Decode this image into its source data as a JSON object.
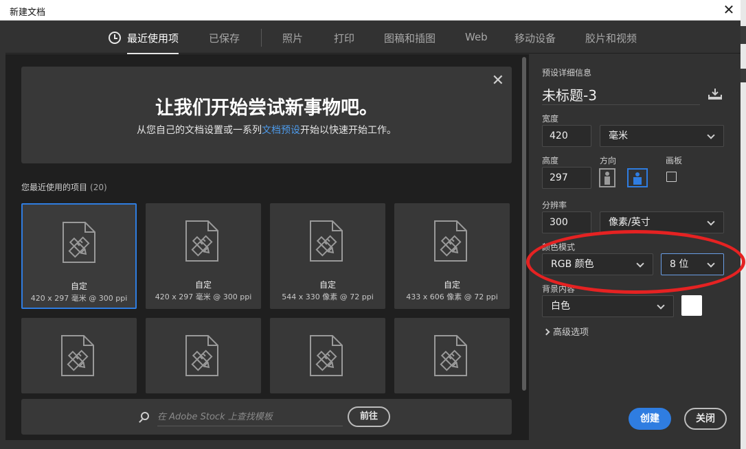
{
  "window": {
    "title": "新建文档",
    "close_glyph": "✕"
  },
  "tabs": [
    {
      "label": "最近使用项",
      "active": true
    },
    {
      "label": "已保存"
    },
    {
      "label": "照片"
    },
    {
      "label": "打印"
    },
    {
      "label": "图稿和插图"
    },
    {
      "label": "Web"
    },
    {
      "label": "移动设备"
    },
    {
      "label": "胶片和视频"
    }
  ],
  "hero": {
    "headline": "让我们开始尝试新事物吧。",
    "text_before": "从您自己的文档设置或一系列",
    "link": "文档预设",
    "text_after": "开始以快速开始工作。",
    "close_glyph": "✕"
  },
  "recent": {
    "heading": "您最近使用的项目",
    "count": "(20)",
    "items": [
      {
        "name": "自定",
        "meta": "420 x 297 毫米 @ 300 ppi",
        "selected": true
      },
      {
        "name": "自定",
        "meta": "420 x 297 毫米 @ 300 ppi"
      },
      {
        "name": "自定",
        "meta": "544 x 330 像素 @ 72 ppi"
      },
      {
        "name": "自定",
        "meta": "433 x 606 像素 @ 72 ppi"
      },
      {
        "name": "",
        "meta": ""
      },
      {
        "name": "",
        "meta": ""
      },
      {
        "name": "",
        "meta": ""
      },
      {
        "name": "",
        "meta": ""
      }
    ]
  },
  "stock": {
    "placeholder": "在 Adobe Stock 上查找模板",
    "go_label": "前往"
  },
  "details": {
    "heading": "预设详细信息",
    "doc_name": "未标题-3",
    "width_label": "宽度",
    "width_value": "420",
    "width_unit": "毫米",
    "height_label": "高度",
    "height_value": "297",
    "orientation_label": "方向",
    "artboard_label": "画板",
    "resolution_label": "分辨率",
    "resolution_value": "300",
    "resolution_unit": "像素/英寸",
    "color_mode_label": "颜色模式",
    "color_mode": "RGB 颜色",
    "bit_depth": "8 位",
    "background_label": "背景内容",
    "background": "白色",
    "background_color": "#ffffff",
    "advanced_label": "高级选项",
    "create_label": "创建",
    "close_label": "关闭"
  },
  "colors": {
    "accent": "#2f7de1",
    "highlight": "#e52222",
    "link": "#4d9aea"
  }
}
